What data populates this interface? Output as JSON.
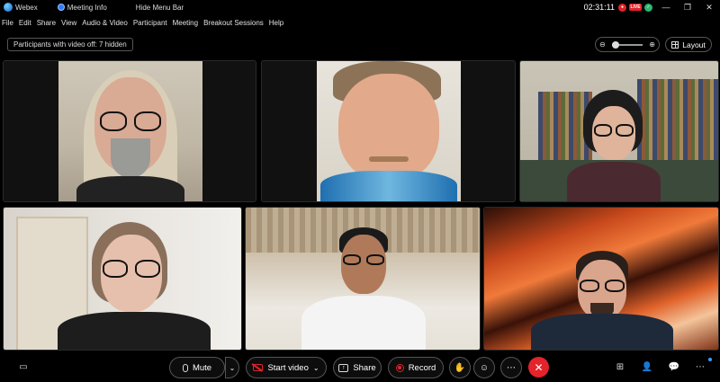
{
  "titlebar": {
    "app_name": "Webex",
    "meeting_info": "Meeting Info",
    "hide_menu": "Hide Menu Bar",
    "time": "02:31:11",
    "live_badge": "LIVE"
  },
  "menu": {
    "items": [
      "File",
      "Edit",
      "Share",
      "View",
      "Audio & Video",
      "Participant",
      "Meeting",
      "Breakout Sessions",
      "Help"
    ]
  },
  "meeting": {
    "hidden_notice": "Participants with video off: 7 hidden",
    "layout_label": "Layout"
  },
  "controls": {
    "mute_label": "Mute",
    "start_video_label": "Start video",
    "share_label": "Share",
    "record_label": "Record"
  },
  "icons": {
    "captions": "captions-icon",
    "mic": "microphone-icon",
    "chevron": "chevron-down-icon",
    "video_off": "video-off-icon",
    "share": "share-screen-icon",
    "record": "record-icon",
    "raise_hand": "raise-hand-icon",
    "reactions": "reactions-icon",
    "more": "more-options-icon",
    "end": "end-call-icon",
    "apps": "apps-icon",
    "participants": "participants-icon",
    "chat": "chat-icon",
    "more_panels": "more-panels-icon"
  },
  "colors": {
    "accent_red": "#e3242b",
    "live_red": "#e0242b",
    "notification_blue": "#3d9bff",
    "border": "#555555"
  }
}
